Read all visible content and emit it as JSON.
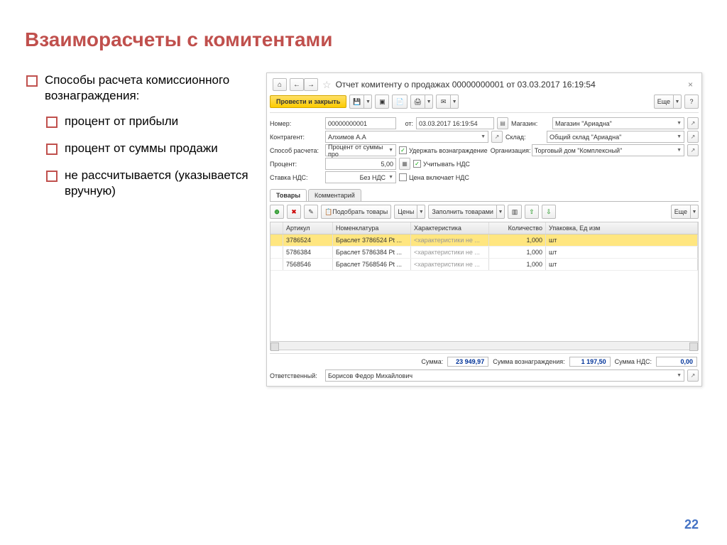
{
  "slide": {
    "title": "Взаиморасчеты с комитентами",
    "page_number": "22",
    "bullet_main": "Способы расчета комиссионного вознаграждения:",
    "sub1": "процент от прибыли",
    "sub2": "процент от суммы продажи",
    "sub3": "не рассчитывается (указывается вручную)"
  },
  "app": {
    "title": "Отчет комитенту о продажах 00000000001 от 03.03.2017 16:19:54",
    "post_close": "Провести и закрыть",
    "more": "Еще",
    "fields": {
      "number_lbl": "Номер:",
      "number": "00000000001",
      "date_lbl": "от:",
      "date": "03.03.2017 16:19:54",
      "shop_lbl": "Магазин:",
      "shop": "Магазин \"Ариадна\"",
      "contragent_lbl": "Контрагент:",
      "contragent": "Алхимов А.А",
      "warehouse_lbl": "Склад:",
      "warehouse": "Общий склад \"Ариадна\"",
      "method_lbl": "Способ расчета:",
      "method": "Процент от суммы про",
      "withhold": "Удержать вознаграждение",
      "org_lbl": "Организация:",
      "org": "Торговый дом \"Комплексный\"",
      "percent_lbl": "Процент:",
      "percent": "5,00",
      "vat_include": "Учитывать НДС",
      "vat_rate_lbl": "Ставка НДС:",
      "vat_rate": "Без НДС",
      "price_incl_vat": "Цена включает НДС"
    },
    "tabs": {
      "t1": "Товары",
      "t2": "Комментарий"
    },
    "tab_toolbar": {
      "pick": "Подобрать товары",
      "prices": "Цены",
      "fill": "Заполнить товарами"
    },
    "grid": {
      "h1": "Артикул",
      "h2": "Номенклатура",
      "h3": "Характеристика",
      "h4": "Количество",
      "h5": "Упаковка, Ед изм",
      "rows": [
        {
          "art": "3786524",
          "nom": "Браслет 3786524 Pt ...",
          "char": "<характеристики не ...",
          "qty": "1,000",
          "unit": "шт"
        },
        {
          "art": "5786384",
          "nom": "Браслет 5786384 Pt ...",
          "char": "<характеристики не ...",
          "qty": "1,000",
          "unit": "шт"
        },
        {
          "art": "7568546",
          "nom": "Браслет 7568546 Pt ...",
          "char": "<характеристики не ...",
          "qty": "1,000",
          "unit": "шт"
        }
      ]
    },
    "totals": {
      "sum_lbl": "Сумма:",
      "sum": "23 949,97",
      "comm_lbl": "Сумма вознаграждения:",
      "comm": "1 197,50",
      "vat_lbl": "Сумма НДС:",
      "vat": "0,00"
    },
    "resp_lbl": "Ответственный:",
    "resp": "Борисов Федор Михайлович"
  }
}
